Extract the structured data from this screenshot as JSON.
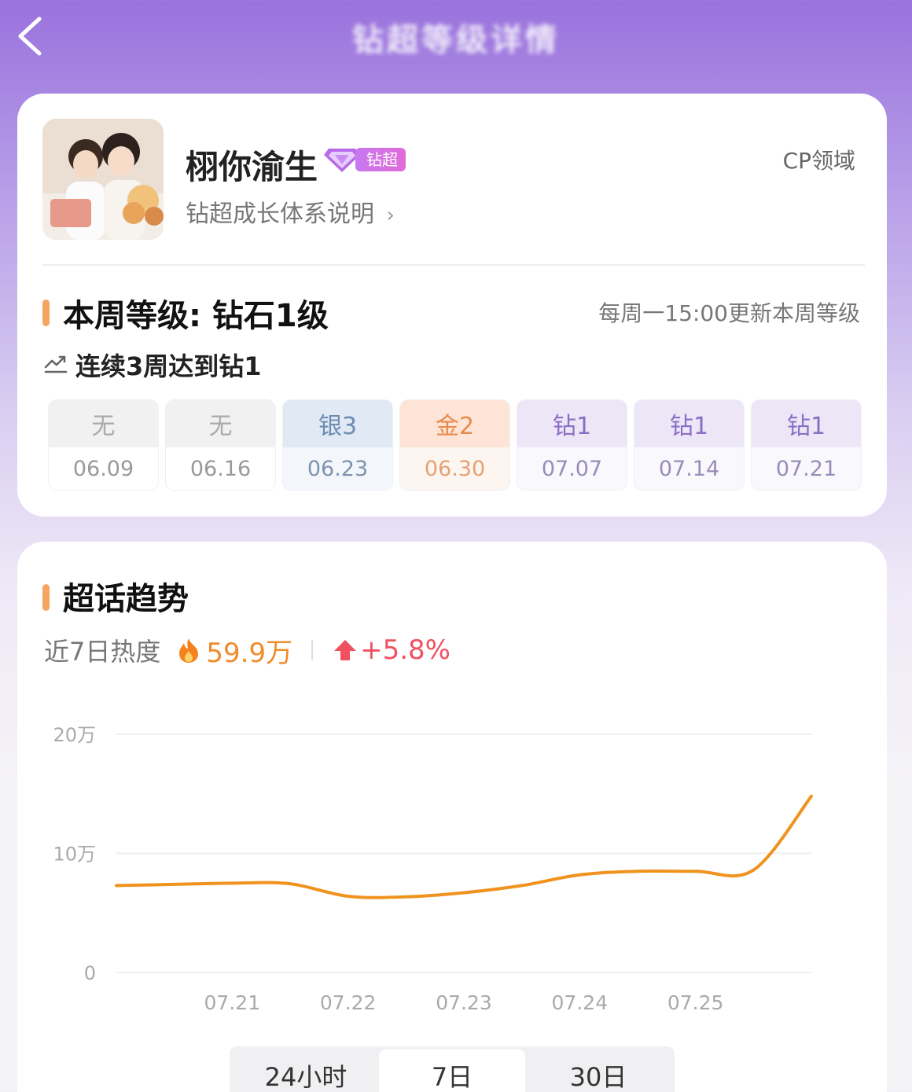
{
  "header": {
    "title": "钻超等级详情"
  },
  "profile": {
    "name": "栩你渝生",
    "badge": "钻超",
    "growth_link": "钻超成长体系说明",
    "domain": "CP领域"
  },
  "level": {
    "title": "本周等级: 钻石1级",
    "update_note": "每周一15:00更新本周等级",
    "streak": "连续3周达到钻1",
    "weeks": [
      {
        "level": "无",
        "date": "06.09",
        "tier": "none"
      },
      {
        "level": "无",
        "date": "06.16",
        "tier": "none"
      },
      {
        "level": "银3",
        "date": "06.23",
        "tier": "silver"
      },
      {
        "level": "金2",
        "date": "06.30",
        "tier": "gold"
      },
      {
        "level": "钻1",
        "date": "07.07",
        "tier": "diamond"
      },
      {
        "level": "钻1",
        "date": "07.14",
        "tier": "diamond"
      },
      {
        "level": "钻1",
        "date": "07.21",
        "tier": "diamond"
      }
    ]
  },
  "trend": {
    "title": "超话趋势",
    "heat_label": "近7日热度",
    "heat_value": "59.9万",
    "heat_change": "+5.8%",
    "tabs": [
      "24小时",
      "7日",
      "30日"
    ],
    "active_tab": 1
  },
  "chart_data": {
    "type": "line",
    "y_tick_labels": [
      "20万",
      "10万",
      "0"
    ],
    "ylim": [
      0,
      200000
    ],
    "x_tick_labels": [
      "07.21",
      "07.22",
      "07.23",
      "07.24",
      "07.25"
    ],
    "x": [
      0,
      0.5,
      1,
      1.5,
      2,
      2.5,
      3,
      3.5,
      4,
      4.5,
      5,
      5.5,
      6
    ],
    "values": [
      73000,
      74000,
      75000,
      74500,
      64000,
      63500,
      67000,
      73000,
      82000,
      85000,
      85000,
      86000,
      148000
    ],
    "line_color": "#f0931e",
    "grid": true
  }
}
